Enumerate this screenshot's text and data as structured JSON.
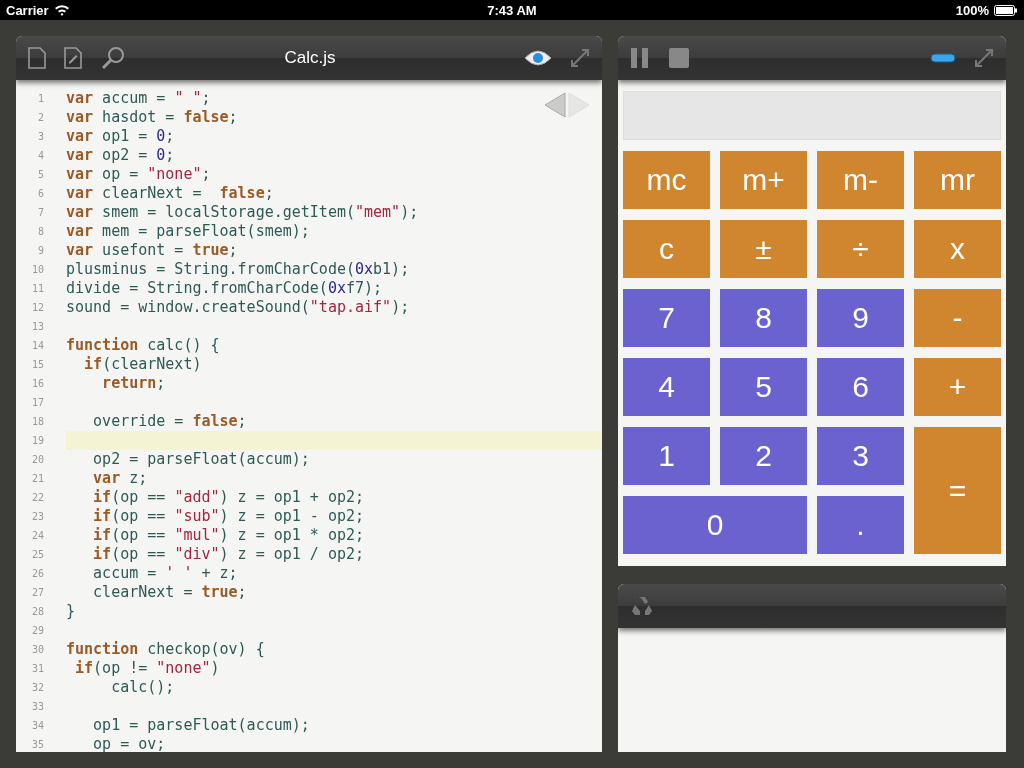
{
  "status_bar": {
    "carrier": "Carrier",
    "time": "7:43 AM",
    "battery": "100%"
  },
  "editor": {
    "title": "Calc.js",
    "lines": [
      {
        "number": "1",
        "highlighted": false,
        "tokens": [
          {
            "kind": "kw",
            "text": "var"
          },
          {
            "kind": "id",
            "text": " accum = "
          },
          {
            "kind": "str",
            "text": "\" \""
          },
          {
            "kind": "id",
            "text": ";"
          }
        ]
      },
      {
        "number": "2",
        "highlighted": false,
        "tokens": [
          {
            "kind": "kw",
            "text": "var"
          },
          {
            "kind": "id",
            "text": " hasdot = "
          },
          {
            "kind": "kw",
            "text": "false"
          },
          {
            "kind": "id",
            "text": ";"
          }
        ]
      },
      {
        "number": "3",
        "highlighted": false,
        "tokens": [
          {
            "kind": "kw",
            "text": "var"
          },
          {
            "kind": "id",
            "text": " op1 = "
          },
          {
            "kind": "num",
            "text": "0"
          },
          {
            "kind": "id",
            "text": ";"
          }
        ]
      },
      {
        "number": "4",
        "highlighted": false,
        "tokens": [
          {
            "kind": "kw",
            "text": "var"
          },
          {
            "kind": "id",
            "text": " op2 = "
          },
          {
            "kind": "num",
            "text": "0"
          },
          {
            "kind": "id",
            "text": ";"
          }
        ]
      },
      {
        "number": "5",
        "highlighted": false,
        "tokens": [
          {
            "kind": "kw",
            "text": "var"
          },
          {
            "kind": "id",
            "text": " op = "
          },
          {
            "kind": "str",
            "text": "\"none\""
          },
          {
            "kind": "id",
            "text": ";"
          }
        ]
      },
      {
        "number": "6",
        "highlighted": false,
        "tokens": [
          {
            "kind": "kw",
            "text": "var"
          },
          {
            "kind": "id",
            "text": " clearNext =  "
          },
          {
            "kind": "kw",
            "text": "false"
          },
          {
            "kind": "id",
            "text": ";"
          }
        ]
      },
      {
        "number": "7",
        "highlighted": false,
        "tokens": [
          {
            "kind": "kw",
            "text": "var"
          },
          {
            "kind": "id",
            "text": " smem = localStorage.getItem("
          },
          {
            "kind": "str",
            "text": "\"mem\""
          },
          {
            "kind": "id",
            "text": ");"
          }
        ]
      },
      {
        "number": "8",
        "highlighted": false,
        "tokens": [
          {
            "kind": "kw",
            "text": "var"
          },
          {
            "kind": "id",
            "text": " mem = parseFloat(smem);"
          }
        ]
      },
      {
        "number": "9",
        "highlighted": false,
        "tokens": [
          {
            "kind": "kw",
            "text": "var"
          },
          {
            "kind": "id",
            "text": " usefont = "
          },
          {
            "kind": "kw",
            "text": "true"
          },
          {
            "kind": "id",
            "text": ";"
          }
        ]
      },
      {
        "number": "10",
        "highlighted": false,
        "tokens": [
          {
            "kind": "id",
            "text": "plusminus = String.fromCharCode("
          },
          {
            "kind": "num",
            "text": "0x"
          },
          {
            "kind": "id",
            "text": "b1);"
          }
        ]
      },
      {
        "number": "11",
        "highlighted": false,
        "tokens": [
          {
            "kind": "id",
            "text": "divide = String.fromCharCode("
          },
          {
            "kind": "num",
            "text": "0x"
          },
          {
            "kind": "id",
            "text": "f7);"
          }
        ]
      },
      {
        "number": "12",
        "highlighted": false,
        "tokens": [
          {
            "kind": "id",
            "text": "sound = window.createSound("
          },
          {
            "kind": "str",
            "text": "\"tap.aif\""
          },
          {
            "kind": "id",
            "text": ");"
          }
        ]
      },
      {
        "number": "13",
        "highlighted": false
      },
      {
        "number": "14",
        "highlighted": false,
        "tokens": [
          {
            "kind": "kw",
            "text": "function"
          },
          {
            "kind": "id",
            "text": " calc() {"
          }
        ]
      },
      {
        "number": "15",
        "highlighted": false,
        "tokens": [
          {
            "kind": "kw",
            "text": "  if"
          },
          {
            "kind": "id",
            "text": "(clearNext)"
          }
        ]
      },
      {
        "number": "16",
        "highlighted": false,
        "tokens": [
          {
            "kind": "kw",
            "text": "    return"
          },
          {
            "kind": "id",
            "text": ";"
          }
        ]
      },
      {
        "number": "17",
        "highlighted": false
      },
      {
        "number": "18",
        "highlighted": false,
        "tokens": [
          {
            "kind": "id",
            "text": "   override = "
          },
          {
            "kind": "kw",
            "text": "false"
          },
          {
            "kind": "id",
            "text": ";"
          }
        ]
      },
      {
        "number": "19",
        "highlighted": true
      },
      {
        "number": "20",
        "highlighted": false,
        "tokens": [
          {
            "kind": "id",
            "text": "   op2 = parseFloat(accum);"
          }
        ]
      },
      {
        "number": "21",
        "highlighted": false,
        "tokens": [
          {
            "kind": "kw",
            "text": "   var"
          },
          {
            "kind": "id",
            "text": " z;"
          }
        ]
      },
      {
        "number": "22",
        "highlighted": false,
        "tokens": [
          {
            "kind": "kw",
            "text": "   if"
          },
          {
            "kind": "id",
            "text": "(op == "
          },
          {
            "kind": "str",
            "text": "\"add\""
          },
          {
            "kind": "id",
            "text": ") z = op1 + op2;"
          }
        ]
      },
      {
        "number": "23",
        "highlighted": false,
        "tokens": [
          {
            "kind": "kw",
            "text": "   if"
          },
          {
            "kind": "id",
            "text": "(op == "
          },
          {
            "kind": "str",
            "text": "\"sub\""
          },
          {
            "kind": "id",
            "text": ") z = op1 - op2;"
          }
        ]
      },
      {
        "number": "24",
        "highlighted": false,
        "tokens": [
          {
            "kind": "kw",
            "text": "   if"
          },
          {
            "kind": "id",
            "text": "(op == "
          },
          {
            "kind": "str",
            "text": "\"mul\""
          },
          {
            "kind": "id",
            "text": ") z = op1 * op2;"
          }
        ]
      },
      {
        "number": "25",
        "highlighted": false,
        "tokens": [
          {
            "kind": "kw",
            "text": "   if"
          },
          {
            "kind": "id",
            "text": "(op == "
          },
          {
            "kind": "str",
            "text": "\"div\""
          },
          {
            "kind": "id",
            "text": ") z = op1 / op2;"
          }
        ]
      },
      {
        "number": "26",
        "highlighted": false,
        "tokens": [
          {
            "kind": "id",
            "text": "   accum = "
          },
          {
            "kind": "str",
            "text": "' '"
          },
          {
            "kind": "id",
            "text": " + z;"
          }
        ]
      },
      {
        "number": "27",
        "highlighted": false,
        "tokens": [
          {
            "kind": "id",
            "text": "   clearNext = "
          },
          {
            "kind": "kw",
            "text": "true"
          },
          {
            "kind": "id",
            "text": ";"
          }
        ]
      },
      {
        "number": "28",
        "highlighted": false,
        "tokens": [
          {
            "kind": "id",
            "text": "}"
          }
        ]
      },
      {
        "number": "29",
        "highlighted": false
      },
      {
        "number": "30",
        "highlighted": false,
        "tokens": [
          {
            "kind": "kw",
            "text": "function"
          },
          {
            "kind": "id",
            "text": " checkop(ov) {"
          }
        ]
      },
      {
        "number": "31",
        "highlighted": false,
        "tokens": [
          {
            "kind": "kw",
            "text": " if"
          },
          {
            "kind": "id",
            "text": "(op != "
          },
          {
            "kind": "str",
            "text": "\"none\""
          },
          {
            "kind": "id",
            "text": ")"
          }
        ]
      },
      {
        "number": "32",
        "highlighted": false,
        "tokens": [
          {
            "kind": "id",
            "text": "     calc();"
          }
        ]
      },
      {
        "number": "33",
        "highlighted": false
      },
      {
        "number": "34",
        "highlighted": false,
        "tokens": [
          {
            "kind": "id",
            "text": "   op1 = parseFloat(accum);"
          }
        ]
      },
      {
        "number": "35",
        "highlighted": false,
        "tokens": [
          {
            "kind": "id",
            "text": "   op = ov;"
          }
        ]
      }
    ]
  },
  "calculator": {
    "keys": [
      {
        "label": "mc",
        "color": "#d0862e",
        "kind": "normal"
      },
      {
        "label": "m+",
        "color": "#d0862e",
        "kind": "normal"
      },
      {
        "label": "m-",
        "color": "#d0862e",
        "kind": "normal"
      },
      {
        "label": "mr",
        "color": "#d0862e",
        "kind": "normal"
      },
      {
        "label": "c",
        "color": "#d0862e",
        "kind": "normal"
      },
      {
        "label": "±",
        "color": "#d0862e",
        "kind": "normal"
      },
      {
        "label": "÷",
        "color": "#d0862e",
        "kind": "normal"
      },
      {
        "label": "x",
        "color": "#d0862e",
        "kind": "normal"
      },
      {
        "label": "7",
        "color": "#6a62cf",
        "kind": "normal"
      },
      {
        "label": "8",
        "color": "#6a62cf",
        "kind": "normal"
      },
      {
        "label": "9",
        "color": "#6a62cf",
        "kind": "normal"
      },
      {
        "label": "-",
        "color": "#d0862e",
        "kind": "normal"
      },
      {
        "label": "4",
        "color": "#6a62cf",
        "kind": "normal"
      },
      {
        "label": "5",
        "color": "#6a62cf",
        "kind": "normal"
      },
      {
        "label": "6",
        "color": "#6a62cf",
        "kind": "normal"
      },
      {
        "label": "+",
        "color": "#d0862e",
        "kind": "normal"
      },
      {
        "label": "1",
        "color": "#6a62cf",
        "kind": "normal"
      },
      {
        "label": "2",
        "color": "#6a62cf",
        "kind": "normal"
      },
      {
        "label": "3",
        "color": "#6a62cf",
        "kind": "normal"
      },
      {
        "label": "=",
        "color": "#d0862e",
        "kind": "tall"
      },
      {
        "label": "0",
        "color": "#6a62cf",
        "kind": "wide"
      },
      {
        "label": ".",
        "color": "#6a62cf",
        "kind": "normal"
      }
    ]
  }
}
